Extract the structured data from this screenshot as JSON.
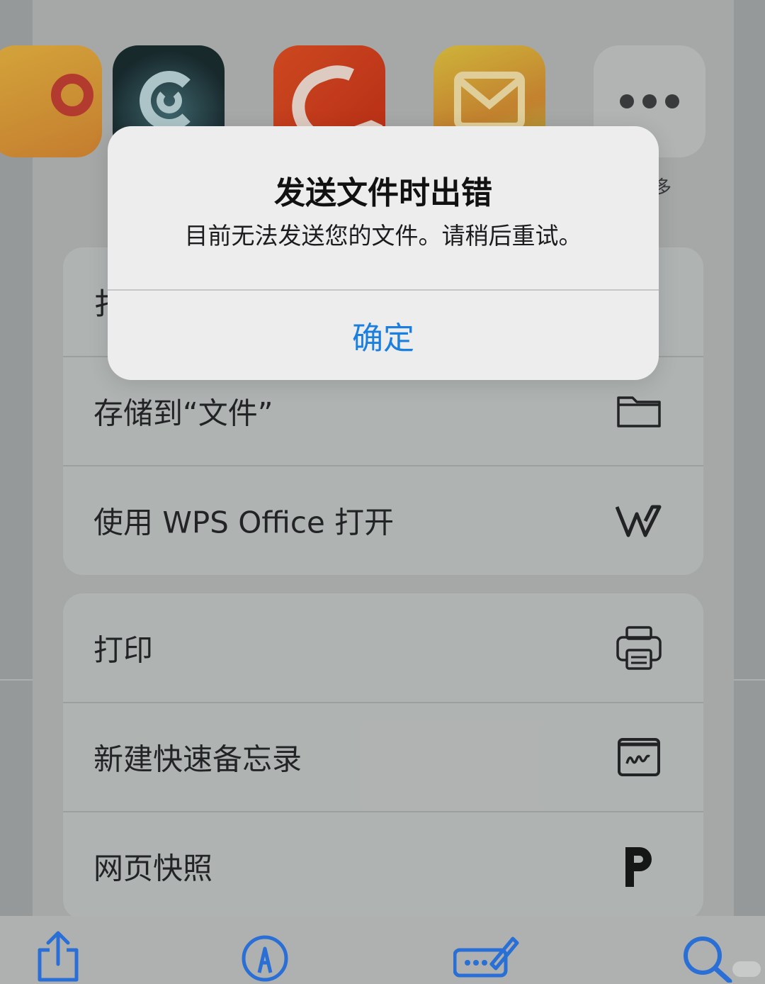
{
  "alert": {
    "title": "发送文件时出错",
    "message": "目前无法发送您的文件。请稍后重试。",
    "confirm_label": "确定"
  },
  "apps": {
    "more_label": "多",
    "items": [
      {
        "icon": "partial-app-icon"
      },
      {
        "icon": "netease-music-icon"
      },
      {
        "icon": "aliexpress-icon"
      },
      {
        "icon": "mail-icon"
      },
      {
        "icon": "more-icon"
      }
    ]
  },
  "actions_group1": [
    {
      "label": "扌",
      "icon": "hidden-action-icon"
    },
    {
      "label": "存储到“文件”",
      "icon": "folder-icon"
    },
    {
      "label": "使用 WPS Office 打开",
      "icon": "wps-icon"
    }
  ],
  "actions_group2": [
    {
      "label": "打印",
      "icon": "printer-icon"
    },
    {
      "label": "新建快速备忘录",
      "icon": "quick-note-icon"
    },
    {
      "label": "网页快照",
      "icon": "p-icon"
    }
  ],
  "toolbar": {
    "items": [
      "share-icon",
      "markup-icon",
      "signature-icon",
      "search-icon"
    ]
  },
  "colors": {
    "accent": "#1b7fe0",
    "toolbar_icon": "#2a6fd6",
    "alert_bg": "#ededee"
  }
}
